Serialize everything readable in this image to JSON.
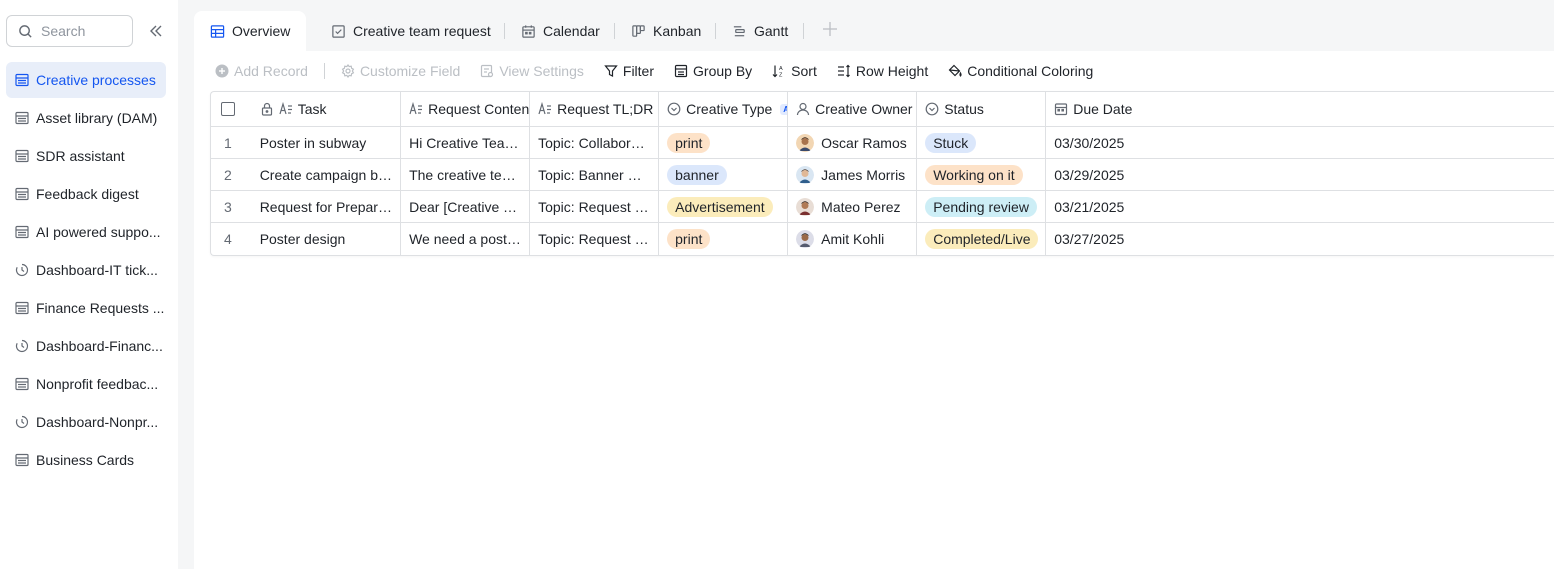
{
  "sidebar": {
    "search_placeholder": "Search",
    "items": [
      {
        "label": "Creative processes",
        "icon": "table-icon",
        "active": true
      },
      {
        "label": "Asset library (DAM)",
        "icon": "table-icon"
      },
      {
        "label": "SDR assistant",
        "icon": "table-icon"
      },
      {
        "label": "Feedback digest",
        "icon": "table-icon"
      },
      {
        "label": "AI powered suppo...",
        "icon": "table-icon"
      },
      {
        "label": "Dashboard-IT tick...",
        "icon": "dashboard-icon"
      },
      {
        "label": "Finance Requests ...",
        "icon": "table-icon"
      },
      {
        "label": "Dashboard-Financ...",
        "icon": "dashboard-icon"
      },
      {
        "label": "Nonprofit feedbac...",
        "icon": "table-icon"
      },
      {
        "label": "Dashboard-Nonpr...",
        "icon": "dashboard-icon"
      },
      {
        "label": "Business Cards",
        "icon": "table-icon"
      }
    ]
  },
  "tabs": [
    {
      "label": "Overview",
      "icon": "grid-view-icon",
      "active": true
    },
    {
      "label": "Creative team request",
      "icon": "form-icon"
    },
    {
      "label": "Calendar",
      "icon": "calendar-icon"
    },
    {
      "label": "Kanban",
      "icon": "kanban-icon"
    },
    {
      "label": "Gantt",
      "icon": "gantt-icon"
    }
  ],
  "toolbar": {
    "add_record": "Add Record",
    "customize_field": "Customize Field",
    "view_settings": "View Settings",
    "filter": "Filter",
    "group_by": "Group By",
    "sort": "Sort",
    "row_height": "Row Height",
    "conditional_coloring": "Conditional Coloring"
  },
  "table": {
    "columns": {
      "task": "Task",
      "request_content": "Request Content",
      "request_tldr": "Request TL;DR",
      "creative_type": "Creative Type",
      "creative_owner": "Creative Owner",
      "status": "Status",
      "due_date": "Due Date"
    },
    "ai_badge": "AI",
    "rows": [
      {
        "index": "1",
        "task": "Poster in subway",
        "request_content": "Hi Creative Team,  I hop...",
        "request_tldr": "Topic: Collaboration Req...",
        "creative_type": "print",
        "creative_type_color": "#fde2c8",
        "owner": "Oscar Ramos",
        "status": "Stuck",
        "status_color": "#dbe7fb",
        "due_date": "03/30/2025"
      },
      {
        "index": "2",
        "task": "Create campaign banner",
        "request_content": "The creative team is req...",
        "request_tldr": "Topic: Banner Creation f...",
        "creative_type": "banner",
        "creative_type_color": "#dbe7fb",
        "owner": "James Morris",
        "status": "Working on it",
        "status_color": "#fde2c8",
        "due_date": "03/29/2025"
      },
      {
        "index": "3",
        "task": "Request for Preparation of N...",
        "request_content": "Dear [Creative Team], I ...",
        "request_tldr": "Topic: Request for Featu...",
        "creative_type": "Advertisement",
        "creative_type_color": "#fbecbb",
        "owner": "Mateo Perez",
        "status": "Pending review",
        "status_color": "#cdeef6",
        "due_date": "03/21/2025"
      },
      {
        "index": "4",
        "task": "Poster design",
        "request_content": "We need a poster desig...",
        "request_tldr": "Topic: Request for Poste...",
        "creative_type": "print",
        "creative_type_color": "#fde2c8",
        "owner": "Amit Kohli",
        "status": "Completed/Live",
        "status_color": "#fbecbb",
        "due_date": "03/27/2025"
      }
    ]
  },
  "colors": {
    "accent": "#1456f0",
    "sidebar_active_bg": "#e8eef9"
  }
}
